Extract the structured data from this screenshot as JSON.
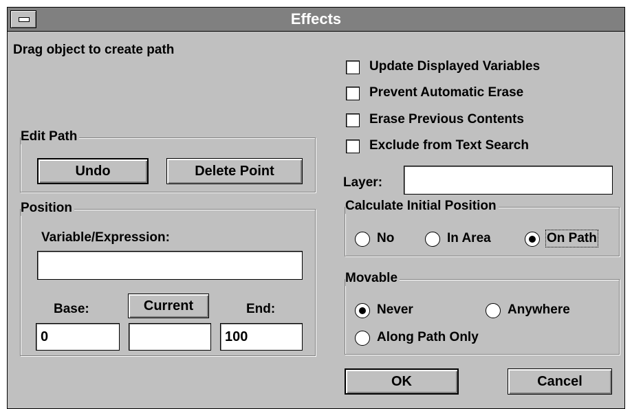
{
  "window": {
    "title": "Effects"
  },
  "instruction": "Drag object to create path",
  "edit_path": {
    "label": "Edit Path",
    "undo": "Undo",
    "delete_point": "Delete Point"
  },
  "position": {
    "label": "Position",
    "variable_label": "Variable/Expression:",
    "variable_value": "",
    "base_label": "Base:",
    "current_button": "Current",
    "end_label": "End:",
    "base_value": "0",
    "current_value": "",
    "end_value": "100"
  },
  "options": [
    {
      "label": "Update Displayed Variables",
      "checked": false
    },
    {
      "label": "Prevent Automatic Erase",
      "checked": false
    },
    {
      "label": "Erase Previous Contents",
      "checked": false
    },
    {
      "label": "Exclude from Text Search",
      "checked": false
    }
  ],
  "layer": {
    "label": "Layer:",
    "value": ""
  },
  "initial_position": {
    "label": "Calculate Initial Position",
    "options": [
      "No",
      "In Area",
      "On Path"
    ],
    "selected": "On Path"
  },
  "movable": {
    "label": "Movable",
    "options": [
      "Never",
      "Anywhere",
      "Along Path Only"
    ],
    "selected": "Never"
  },
  "buttons": {
    "ok": "OK",
    "cancel": "Cancel"
  },
  "colors": {
    "face": "#c0c0c0",
    "titlebar": "#808080",
    "field": "#ffffff"
  }
}
